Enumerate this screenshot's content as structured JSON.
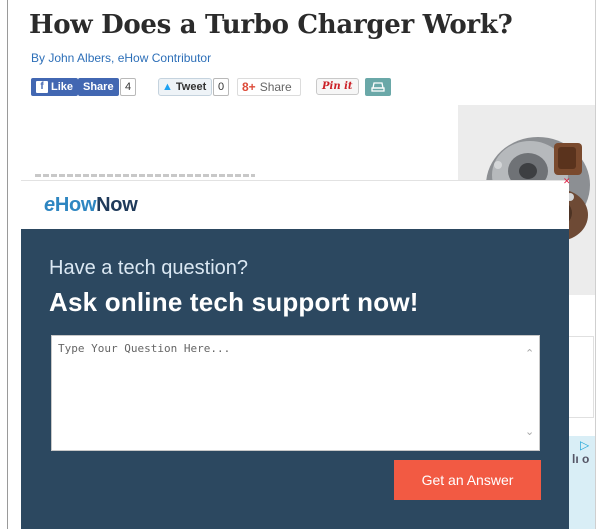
{
  "article": {
    "title": "How Does a Turbo Charger Work?",
    "byline": "By John Albers, eHow Contributor"
  },
  "social": {
    "fb_like_label": "Like",
    "fb_share_label": "Share",
    "fb_count": "4",
    "tweet_label": "Tweet",
    "tweet_count": "0",
    "gplus_label": "Share",
    "gplus_glyph": "8+",
    "pinit_label": "Pin it",
    "print_icon": "print-icon"
  },
  "modal": {
    "brand_e": "e",
    "brand_how": "How",
    "brand_now": "Now",
    "prompt": "Have a tech question?",
    "headline": "Ask online tech support now!",
    "question_placeholder": "Type Your Question Here...",
    "submit_label": "Get an Answer"
  },
  "ad": {
    "glyph": "lı o"
  },
  "colors": {
    "modal_bg": "#2c4860",
    "button": "#f25a43",
    "link": "#2d6fb8",
    "facebook": "#4267b2"
  }
}
